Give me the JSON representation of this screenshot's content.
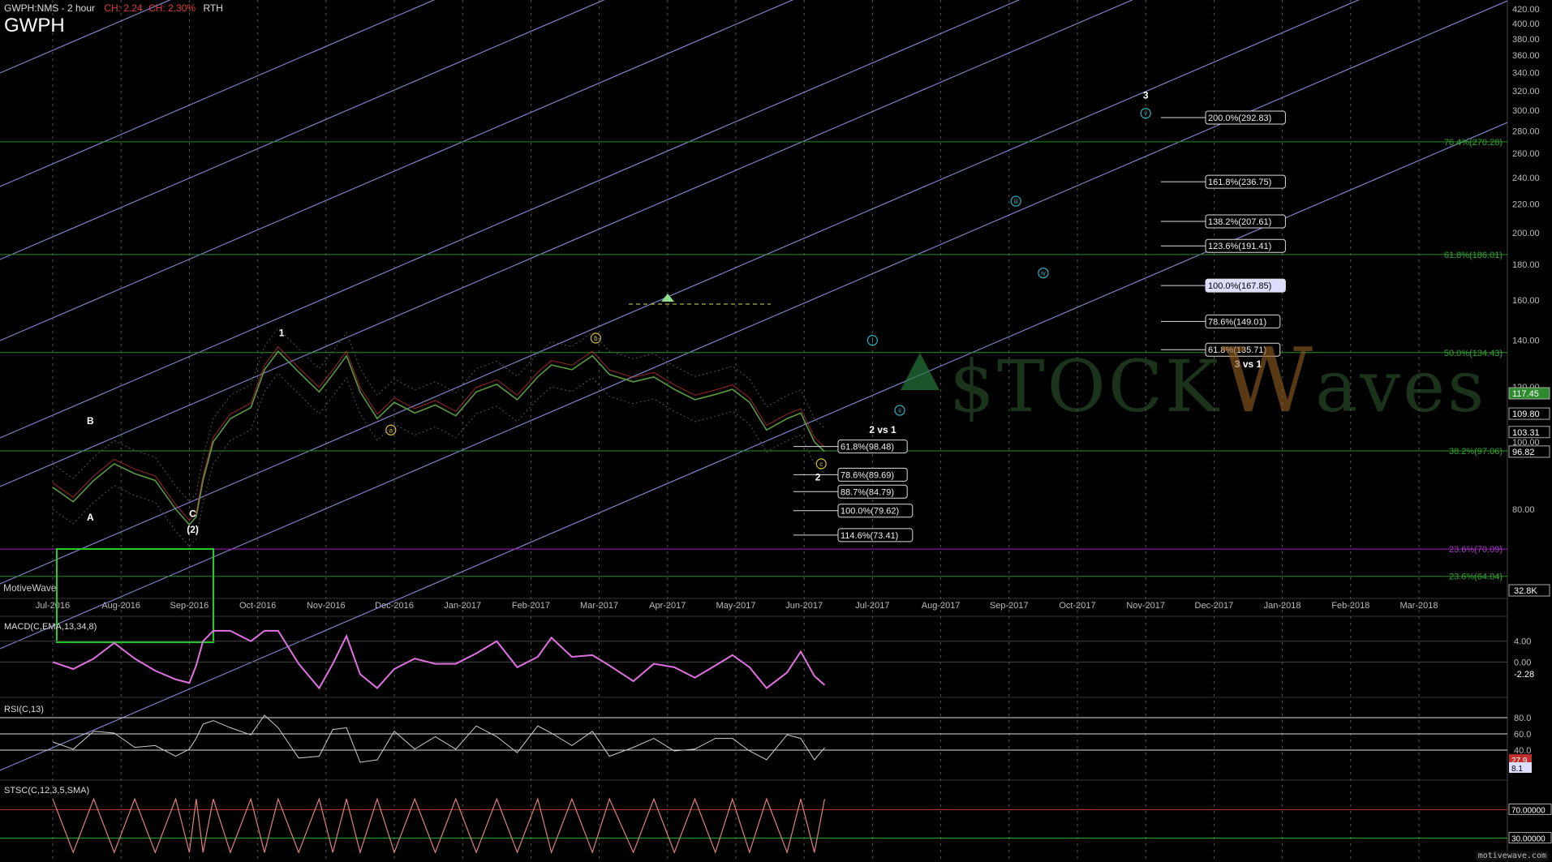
{
  "header": {
    "symbol_period": "GWPH:NMS - 2 hour",
    "change1": "CH: 2.24",
    "change2": "CH: 2.30%",
    "session": "RTH",
    "symbol": "GWPH"
  },
  "brand": "MotiveWave",
  "footer": "motivewave.com",
  "watermark": {
    "text": "$TOCK",
    "w": "W",
    "rest": "aves"
  },
  "panels": {
    "macd": "MACD(C,EMA,13,34,8)",
    "rsi": "RSI(C,13)",
    "stoch": "STSC(C,12,3,5,SMA)"
  },
  "chart_data": {
    "type": "line",
    "x_labels": [
      "Jul-2016",
      "Aug-2016",
      "Sep-2016",
      "Oct-2016",
      "Nov-2016",
      "Dec-2016",
      "Jan-2017",
      "Feb-2017",
      "Mar-2017",
      "Apr-2017",
      "May-2017",
      "Jun-2017",
      "Jul-2017",
      "Aug-2017",
      "Sep-2017",
      "Oct-2017",
      "Nov-2017",
      "Dec-2017",
      "Jan-2018",
      "Feb-2018",
      "Mar-2018"
    ],
    "y_ticks": [
      "420.00",
      "400.00",
      "380.00",
      "360.00",
      "340.00",
      "320.00",
      "300.00",
      "280.00",
      "260.00",
      "240.00",
      "220.00",
      "200.00",
      "180.00",
      "160.00",
      "140.00",
      "120.00",
      "100.00",
      "80.00"
    ],
    "ylim": [
      60,
      430
    ],
    "scale": "log",
    "price_series": [
      {
        "x": 0,
        "y": 86
      },
      {
        "x": 0.3,
        "y": 82
      },
      {
        "x": 0.6,
        "y": 88
      },
      {
        "x": 0.9,
        "y": 93
      },
      {
        "x": 1.2,
        "y": 90
      },
      {
        "x": 1.5,
        "y": 88
      },
      {
        "x": 1.8,
        "y": 80
      },
      {
        "x": 2.0,
        "y": 76
      },
      {
        "x": 2.1,
        "y": 78
      },
      {
        "x": 2.2,
        "y": 88
      },
      {
        "x": 2.35,
        "y": 100
      },
      {
        "x": 2.6,
        "y": 108
      },
      {
        "x": 2.9,
        "y": 112
      },
      {
        "x": 3.1,
        "y": 127
      },
      {
        "x": 3.3,
        "y": 135
      },
      {
        "x": 3.6,
        "y": 126
      },
      {
        "x": 3.9,
        "y": 118
      },
      {
        "x": 4.1,
        "y": 125
      },
      {
        "x": 4.3,
        "y": 133
      },
      {
        "x": 4.5,
        "y": 118
      },
      {
        "x": 4.75,
        "y": 108
      },
      {
        "x": 5.0,
        "y": 114
      },
      {
        "x": 5.3,
        "y": 110
      },
      {
        "x": 5.6,
        "y": 113
      },
      {
        "x": 5.9,
        "y": 109
      },
      {
        "x": 6.2,
        "y": 118
      },
      {
        "x": 6.5,
        "y": 121
      },
      {
        "x": 6.8,
        "y": 115
      },
      {
        "x": 7.1,
        "y": 124
      },
      {
        "x": 7.3,
        "y": 129
      },
      {
        "x": 7.6,
        "y": 127
      },
      {
        "x": 7.9,
        "y": 133
      },
      {
        "x": 8.15,
        "y": 125
      },
      {
        "x": 8.5,
        "y": 122
      },
      {
        "x": 8.8,
        "y": 124
      },
      {
        "x": 9.1,
        "y": 119
      },
      {
        "x": 9.4,
        "y": 115
      },
      {
        "x": 9.7,
        "y": 117
      },
      {
        "x": 9.95,
        "y": 119
      },
      {
        "x": 10.2,
        "y": 114
      },
      {
        "x": 10.45,
        "y": 104
      },
      {
        "x": 10.75,
        "y": 108
      },
      {
        "x": 10.95,
        "y": 110
      },
      {
        "x": 11.15,
        "y": 100
      },
      {
        "x": 11.3,
        "y": 96.8
      }
    ],
    "last_price": "96.82",
    "price_labels": [
      "117.45",
      "109.80",
      "103.31",
      "96.82"
    ],
    "volume_label": "32.8K",
    "fib_targets": [
      {
        "label": "200.0%(292.83)",
        "y": 292.83
      },
      {
        "label": "161.8%(236.75)",
        "y": 236.75
      },
      {
        "label": "138.2%(207.61)",
        "y": 207.61
      },
      {
        "label": "123.6%(191.41)",
        "y": 191.41
      },
      {
        "label": "100.0%(167.85)",
        "y": 167.85
      },
      {
        "label": "78.6%(149.01)",
        "y": 149.01
      },
      {
        "label": "61.8%(135.71)",
        "y": 135.71
      }
    ],
    "fib_retraces": [
      {
        "label": "61.8%(98.48)",
        "y": 98.48
      },
      {
        "label": "78.6%(89.69)",
        "y": 89.69
      },
      {
        "label": "88.7%(84.79)",
        "y": 84.79
      },
      {
        "label": "100.0%(79.62)",
        "y": 79.62
      },
      {
        "label": "114.6%(73.41)",
        "y": 73.41
      }
    ],
    "horizontal_levels": [
      {
        "label": "76.4%(270.28)",
        "y": 270.28
      },
      {
        "label": "61.8%(186.01)",
        "y": 186.01
      },
      {
        "label": "50.0%(134.43)",
        "y": 134.43
      },
      {
        "label": "38.2%(97.06)",
        "y": 97.06
      },
      {
        "label": "23.6%(70.09)",
        "y": 70.09
      },
      {
        "label": "23.6%(64.04)",
        "y": 64.04
      }
    ],
    "wave_labels": [
      {
        "text": "1",
        "x": 3.35,
        "y": 142
      },
      {
        "text": "B",
        "x": 0.55,
        "y": 106
      },
      {
        "text": "A",
        "x": 0.55,
        "y": 77
      },
      {
        "text": "C",
        "x": 2.05,
        "y": 78
      },
      {
        "text": "(2)",
        "x": 2.05,
        "y": 74
      },
      {
        "text": "a",
        "x": 4.95,
        "y": 104
      },
      {
        "text": "b",
        "x": 7.95,
        "y": 141
      },
      {
        "text": "c",
        "x": 11.25,
        "y": 93
      },
      {
        "text": "2",
        "x": 11.2,
        "y": 88
      },
      {
        "text": "2 vs 1",
        "x": 12.15,
        "y": 103
      },
      {
        "text": "i",
        "x": 12.0,
        "y": 140
      },
      {
        "text": "ii",
        "x": 12.4,
        "y": 111
      },
      {
        "text": "iii",
        "x": 14.1,
        "y": 222
      },
      {
        "text": "iv",
        "x": 14.5,
        "y": 175
      },
      {
        "text": "v",
        "x": 16.0,
        "y": 297
      },
      {
        "text": "3",
        "x": 16.0,
        "y": 312
      },
      {
        "text": "3 vs 1",
        "x": 17.5,
        "y": 128
      }
    ],
    "macd": {
      "ticks": [
        "4.00",
        "0.00"
      ],
      "last": "-2.28",
      "ylim": [
        -6,
        8
      ]
    },
    "rsi": {
      "ticks": [
        "80.0",
        "60.0",
        "40.0"
      ],
      "last1": "27.9",
      "last2": "8.1",
      "ylim": [
        10,
        95
      ]
    },
    "stoch": {
      "ticks": [
        "70.00000",
        "30.00000"
      ],
      "ylim": [
        0,
        100
      ]
    }
  }
}
